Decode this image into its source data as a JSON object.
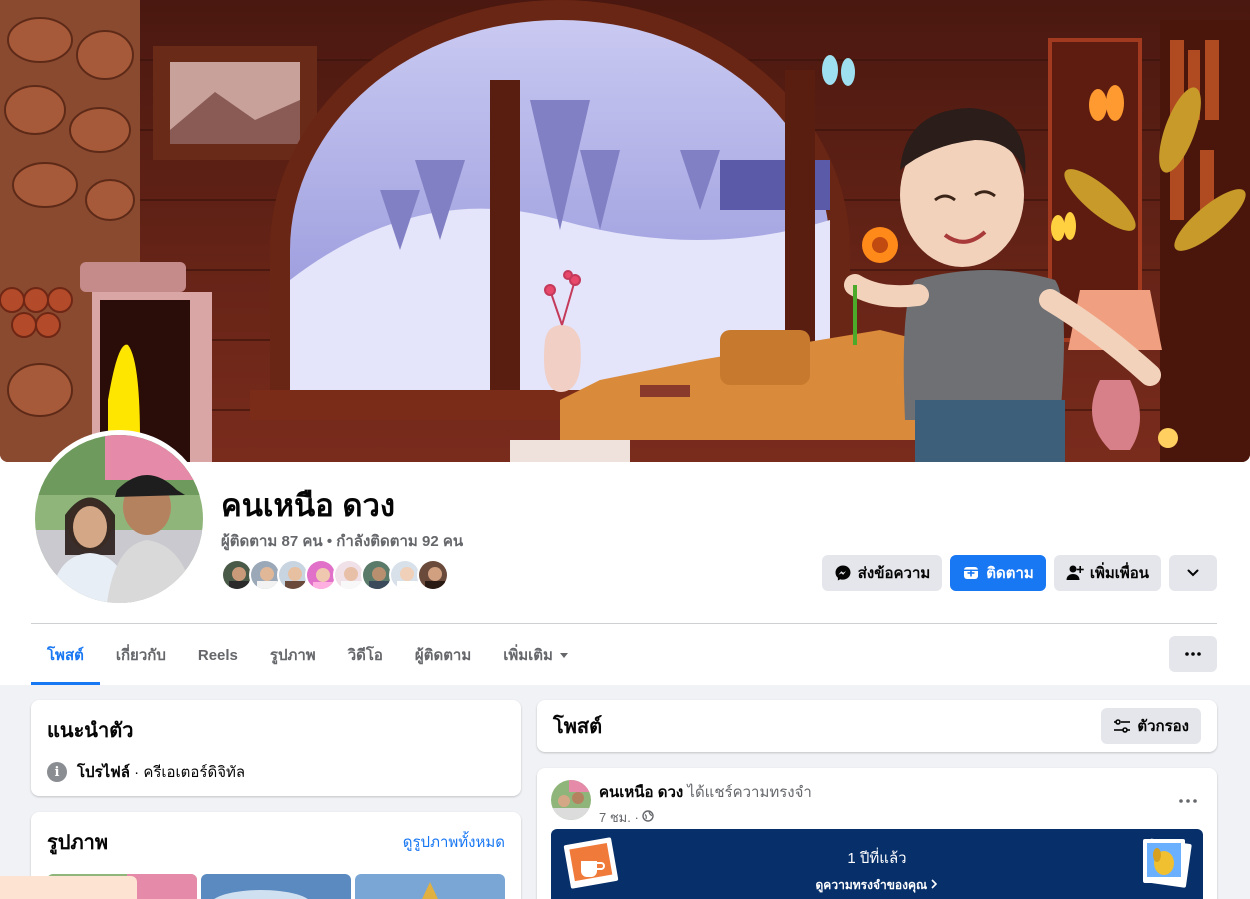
{
  "profile": {
    "name": "คนเหนือ ดวง",
    "followers": "ผู้ติดตาม 87 คน",
    "separator": "•",
    "following": "กำลังติดตาม 92 คน"
  },
  "actions": {
    "message": "ส่งข้อความ",
    "follow": "ติดตาม",
    "add_friend": "เพิ่มเพื่อน"
  },
  "tabs": [
    {
      "label": "โพสต์",
      "active": true
    },
    {
      "label": "เกี่ยวกับ"
    },
    {
      "label": "Reels"
    },
    {
      "label": "รูปภาพ"
    },
    {
      "label": "วิดีโอ"
    },
    {
      "label": "ผู้ติดตาม"
    },
    {
      "label": "เพิ่มเติม"
    }
  ],
  "intro": {
    "title": "แนะนำตัว",
    "profile_label": "โปรไฟล์",
    "profile_type": " · ครีเอเตอร์ดิจิทัล"
  },
  "photos": {
    "title": "รูปภาพ",
    "see_all": "ดูรูปภาพทั้งหมด"
  },
  "posts": {
    "title": "โพสต์",
    "filter": "ตัวกรอง"
  },
  "post": {
    "author": "คนเหนือ ดวง",
    "action": " ได้แชร์ความทรงจำ",
    "time": "7 ชม. ·",
    "memory_title": "1 ปีที่แล้ว",
    "memory_link": "ดูความทรงจำของคุณ"
  },
  "colors": {
    "brand_blue": "#1877f2",
    "memory_bg": "#072f6a",
    "secondary_text": "#65676b"
  }
}
